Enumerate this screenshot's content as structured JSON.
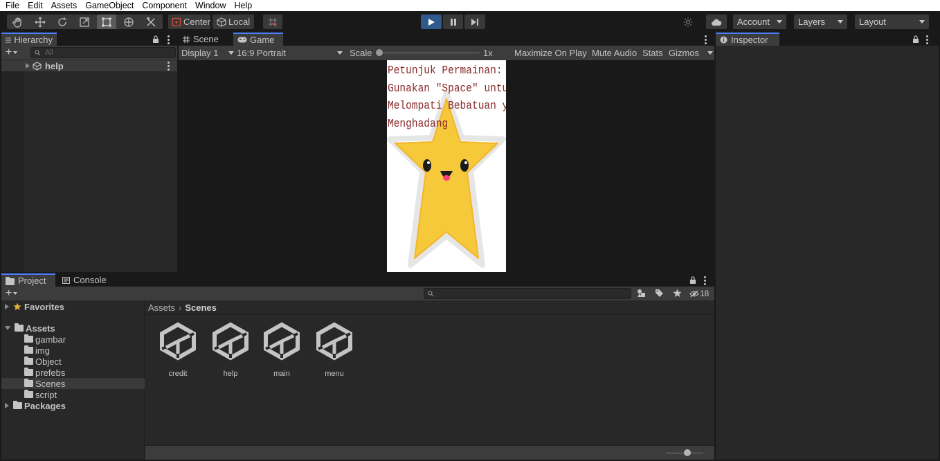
{
  "menu": [
    "File",
    "Edit",
    "Assets",
    "GameObject",
    "Component",
    "Window",
    "Help"
  ],
  "toolbar": {
    "tools": [
      "hand-tool",
      "move-tool",
      "rotate-tool",
      "scale-tool",
      "rect-tool",
      "transform-tool",
      "custom-tool"
    ],
    "pivot_label": "Center",
    "space_label": "Local",
    "account_label": "Account",
    "layers_label": "Layers",
    "layout_label": "Layout"
  },
  "hierarchy": {
    "tab_label": "Hierarchy",
    "search_placeholder": "All",
    "items": [
      {
        "label": "help"
      }
    ]
  },
  "game_view": {
    "tabs": [
      {
        "label": "Scene"
      },
      {
        "label": "Game"
      }
    ],
    "display_label": "Display 1",
    "aspect_label": "16:9 Portrait",
    "scale_label": "Scale",
    "scale_value": "1x",
    "maximize_label": "Maximize On Play",
    "mute_label": "Mute Audio",
    "stats_label": "Stats",
    "gizmos_label": "Gizmos",
    "instructions": [
      "Petunjuk Permainan:",
      "Gunakan \"Space\" untuk",
      "Melompati Bebatuan yang",
      "Menghadang"
    ],
    "instruction_color": "#8a2a2a"
  },
  "inspector": {
    "tab_label": "Inspector"
  },
  "project": {
    "tabs": [
      {
        "label": "Project"
      },
      {
        "label": "Console"
      }
    ],
    "hidden_count": "18",
    "tree": {
      "favorites": "Favorites",
      "assets": "Assets",
      "folders": [
        "gambar",
        "img",
        "Object",
        "prefebs",
        "Scenes",
        "script"
      ],
      "packages": "Packages"
    },
    "breadcrumb": [
      "Assets",
      "Scenes"
    ],
    "scenes": [
      "credit",
      "help",
      "main",
      "menu"
    ]
  },
  "colors": {
    "accent": "#4c7fff",
    "play": "#2e5b8c",
    "star": "#f6c93a"
  }
}
